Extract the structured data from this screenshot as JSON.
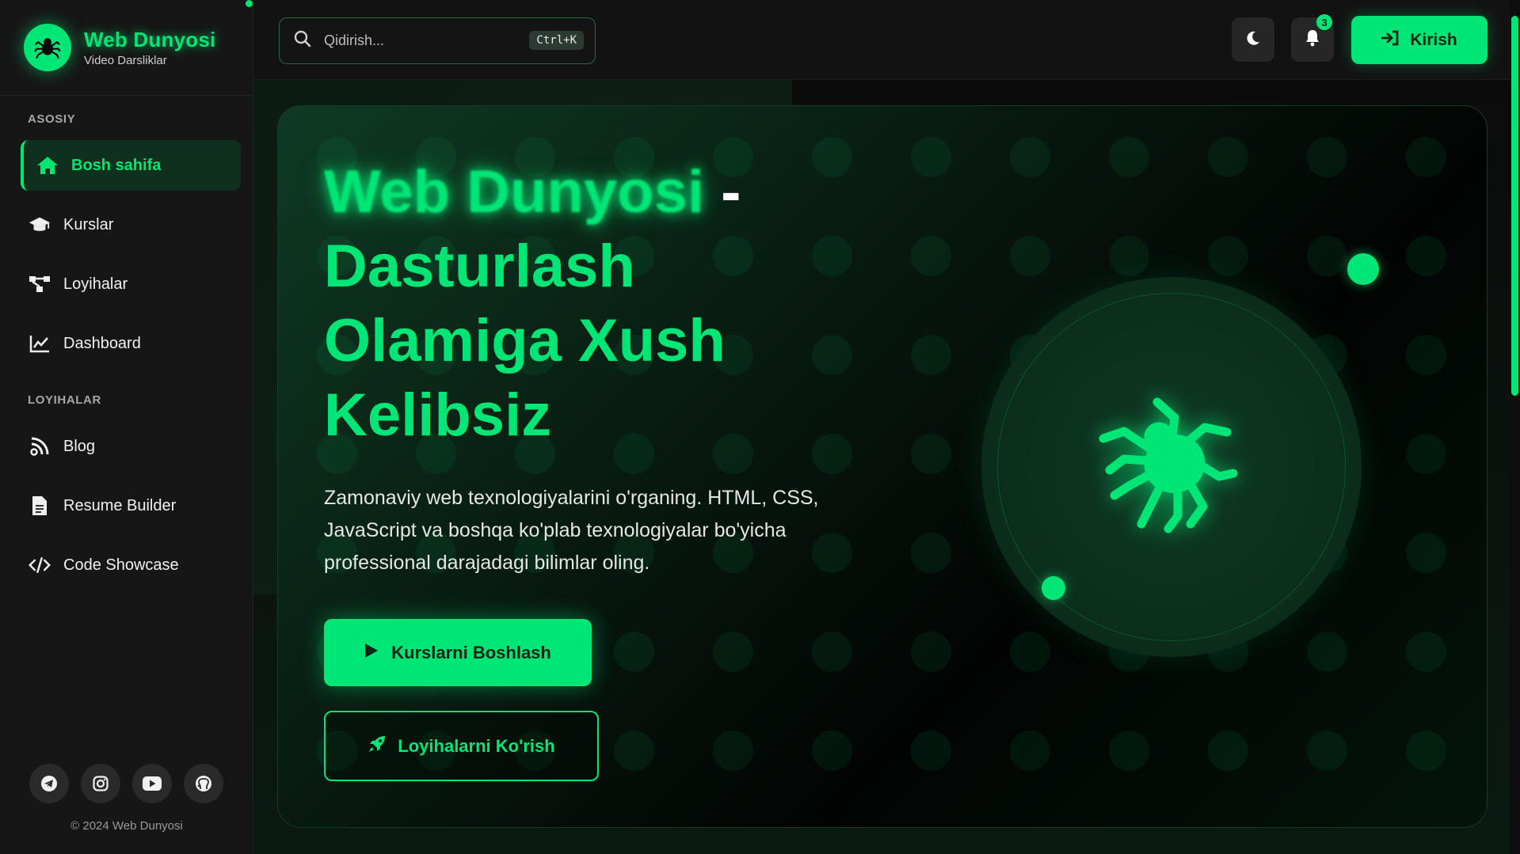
{
  "brand": {
    "title": "Web Dunyosi",
    "subtitle": "Video Darsliklar",
    "logo_icon": "spider-icon"
  },
  "sidebar": {
    "sections": [
      {
        "label": "ASOSIY",
        "items": [
          {
            "label": "Bosh sahifa",
            "icon": "home-icon",
            "active": true
          },
          {
            "label": "Kurslar",
            "icon": "graduation-cap-icon",
            "active": false
          },
          {
            "label": "Loyihalar",
            "icon": "project-diagram-icon",
            "active": false
          },
          {
            "label": "Dashboard",
            "icon": "chart-line-icon",
            "active": false
          }
        ]
      },
      {
        "label": "LOYIHALAR",
        "items": [
          {
            "label": "Blog",
            "icon": "blog-icon",
            "active": false
          },
          {
            "label": "Resume Builder",
            "icon": "file-icon",
            "active": false
          },
          {
            "label": "Code Showcase",
            "icon": "code-icon",
            "active": false
          }
        ]
      }
    ],
    "socials": [
      "telegram-icon",
      "instagram-icon",
      "youtube-icon",
      "github-icon"
    ],
    "copyright": "© 2024 Web Dunyosi"
  },
  "topbar": {
    "search_placeholder": "Qidirish...",
    "search_shortcut": "Ctrl+K",
    "notification_count": "3",
    "login_label": "Kirish"
  },
  "hero": {
    "title_brand": "Web Dunyosi",
    "title_dash": "-",
    "title_rest": "Dasturlash Olamiga Xush Kelibsiz",
    "description": "Zamonaviy web texnologiyalarini o'rganing. HTML, CSS, JavaScript va boshqa ko'plab texnologiyalar bo'yicha professional darajadagi bilimlar oling.",
    "primary_button": "Kurslarni Boshlash",
    "secondary_button": "Loyihalarni Ko'rish"
  },
  "colors": {
    "accent": "#00e676",
    "background": "#0d0d0d",
    "sidebar": "#161616"
  }
}
